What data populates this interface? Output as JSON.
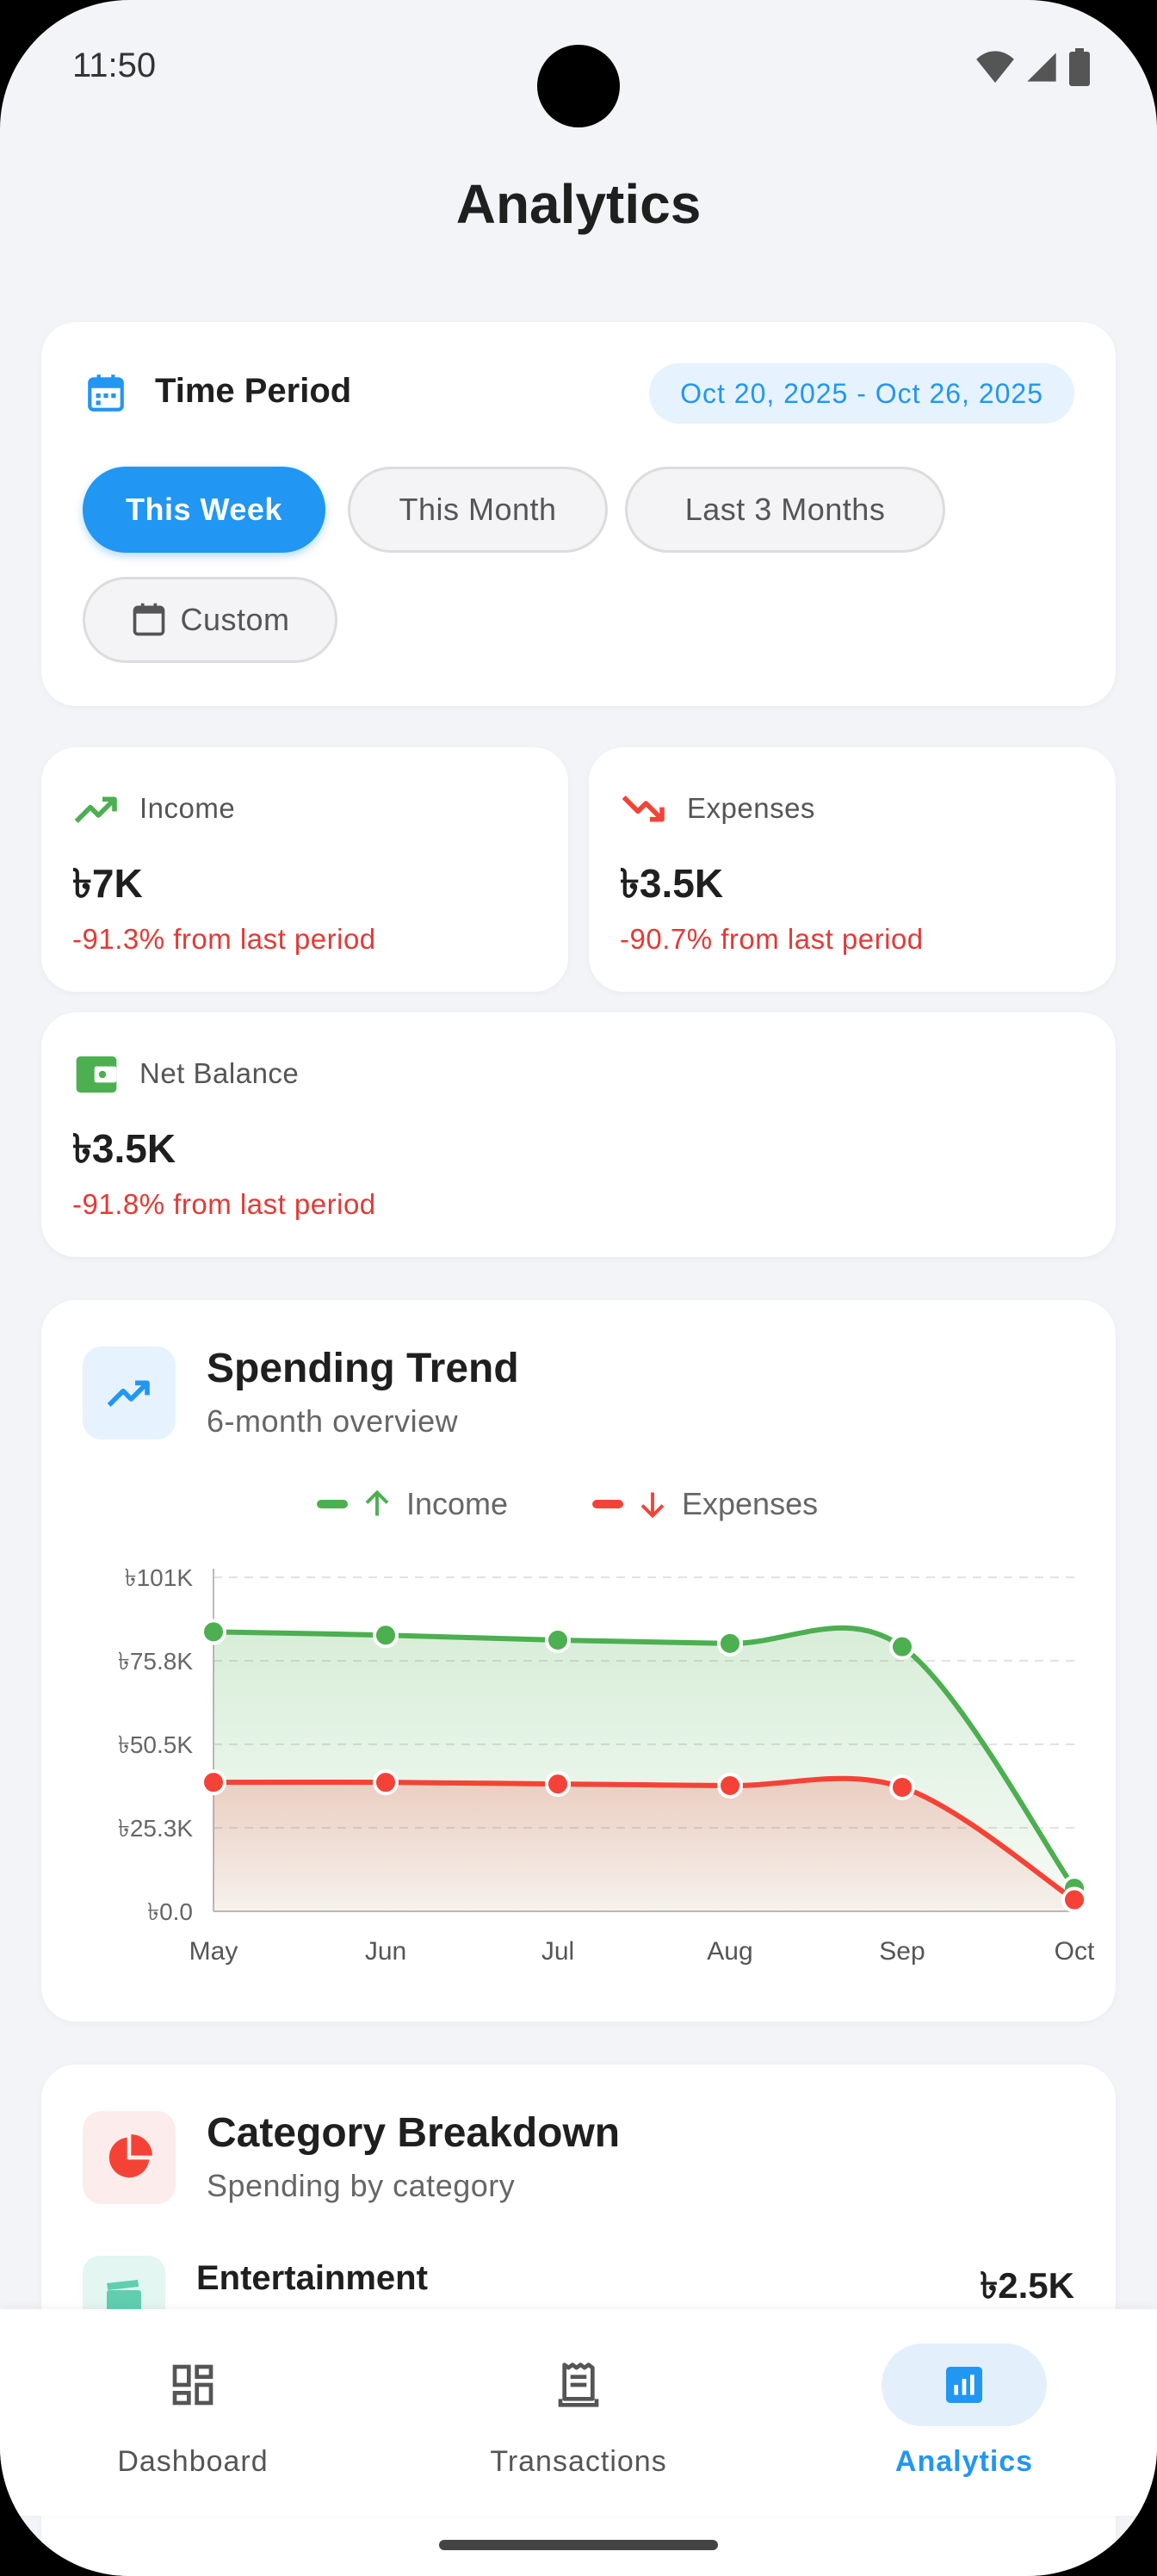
{
  "status_bar": {
    "time": "11:50"
  },
  "page": {
    "title": "Analytics"
  },
  "time_period": {
    "title": "Time Period",
    "range": "Oct 20, 2025 - Oct 26, 2025",
    "options": [
      "This Week",
      "This Month",
      "Last 3 Months",
      "Custom"
    ],
    "selected": "This Week"
  },
  "stats": {
    "income": {
      "label": "Income",
      "value": "৳7K",
      "change": "-91.3% from last period"
    },
    "expenses": {
      "label": "Expenses",
      "value": "৳3.5K",
      "change": "-90.7% from last period"
    },
    "net_balance": {
      "label": "Net Balance",
      "value": "৳3.5K",
      "change": "-91.8% from last period"
    }
  },
  "spending_trend": {
    "title": "Spending Trend",
    "subtitle": "6-month overview",
    "legend": {
      "income": "Income",
      "expenses": "Expenses"
    },
    "colors": {
      "income": "#4caf50",
      "expenses": "#f44336"
    }
  },
  "chart_data": {
    "type": "area",
    "categories": [
      "May",
      "Jun",
      "Jul",
      "Aug",
      "Sep",
      "Oct"
    ],
    "series": [
      {
        "name": "Income",
        "values": [
          84500,
          83500,
          82000,
          81000,
          80000,
          7000
        ]
      },
      {
        "name": "Expenses",
        "values": [
          39000,
          39000,
          38500,
          38000,
          37500,
          3500
        ]
      }
    ],
    "y_ticks": [
      "৳0.0",
      "৳25.3K",
      "৳50.5K",
      "৳75.8K",
      "৳101K"
    ],
    "ylim": [
      0,
      101000
    ],
    "grid": true,
    "legend_position": "top"
  },
  "category_breakdown": {
    "title": "Category Breakdown",
    "subtitle": "Spending by category",
    "items": [
      {
        "name": "Entertainment",
        "amount": "৳2.5K"
      }
    ]
  },
  "bottom_nav": {
    "items": [
      {
        "label": "Dashboard"
      },
      {
        "label": "Transactions"
      },
      {
        "label": "Analytics"
      }
    ],
    "active": "Analytics"
  }
}
